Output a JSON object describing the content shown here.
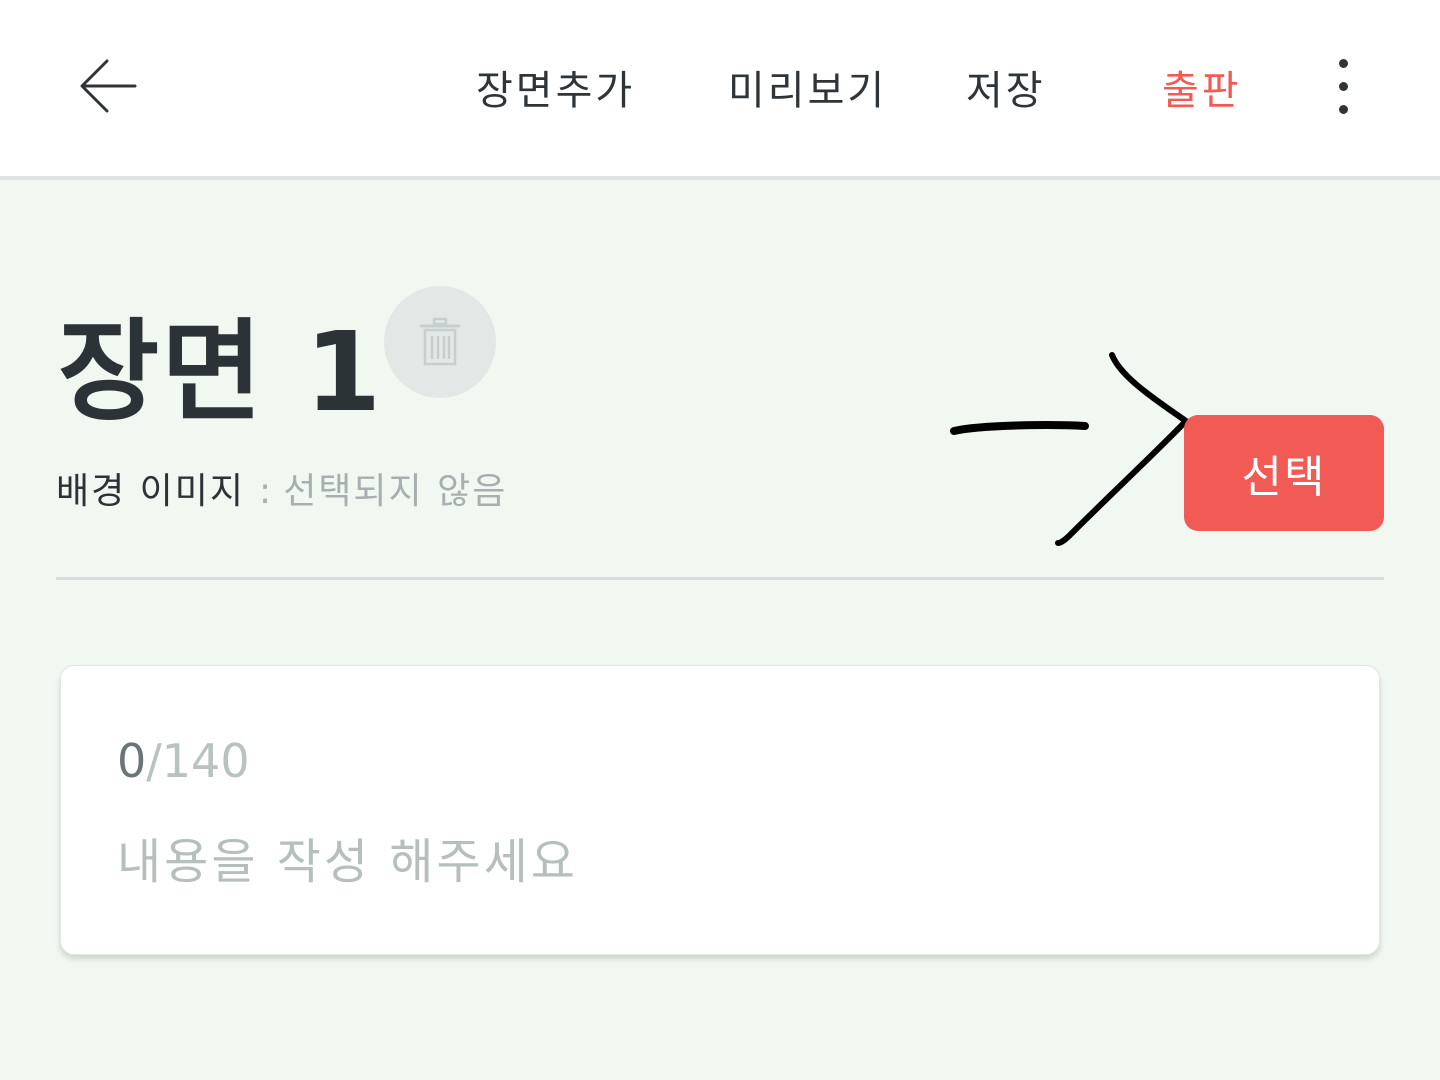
{
  "header": {
    "back_icon": "arrow-left-icon",
    "nav": {
      "add_scene": "장면추가",
      "preview": "미리보기",
      "save": "저장",
      "publish": "출판"
    },
    "more_icon": "more-vertical-icon",
    "accent_color": "#f25a55"
  },
  "scene": {
    "title": "장면 1",
    "delete_icon": "trash-icon",
    "background": {
      "label": "배경 이미지",
      "separator": ":",
      "value": "선택되지 않음",
      "select_button": "선택"
    }
  },
  "content": {
    "count_current": "0",
    "count_max": "/140",
    "value": "",
    "placeholder": "내용을 작성 해주세요"
  },
  "annotation": {
    "icon": "hand-drawn-arrow-icon"
  }
}
